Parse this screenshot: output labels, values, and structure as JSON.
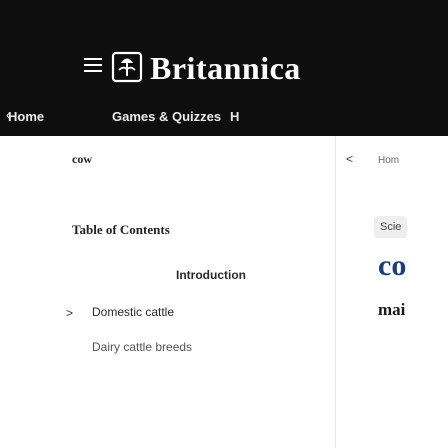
{
  "header": {
    "brand": "Britannica",
    "nav": [
      {
        "label": "Home"
      },
      {
        "label": "Games & Quizzes"
      },
      {
        "label": "H"
      }
    ]
  },
  "article": {
    "search_word": "cow",
    "breadcrumb_home": "Hom",
    "category_badge": "Scie",
    "title": "co",
    "subtitle": "mai"
  },
  "toc": {
    "title": "Table of Contents",
    "items": [
      {
        "label": "Introduction"
      },
      {
        "label": "Domestic cattle"
      },
      {
        "label": "Dairy cattle breeds"
      }
    ]
  },
  "icons": {
    "menu": "hamburger-menu-icon",
    "logo": "thistle-logo-icon",
    "nav_left": "chevron-left-icon",
    "back": "chevron-left-icon",
    "expand": "chevron-right-icon"
  },
  "colors": {
    "header_bg": "#0e0e0e",
    "title_blue": "#1b3f7a"
  }
}
